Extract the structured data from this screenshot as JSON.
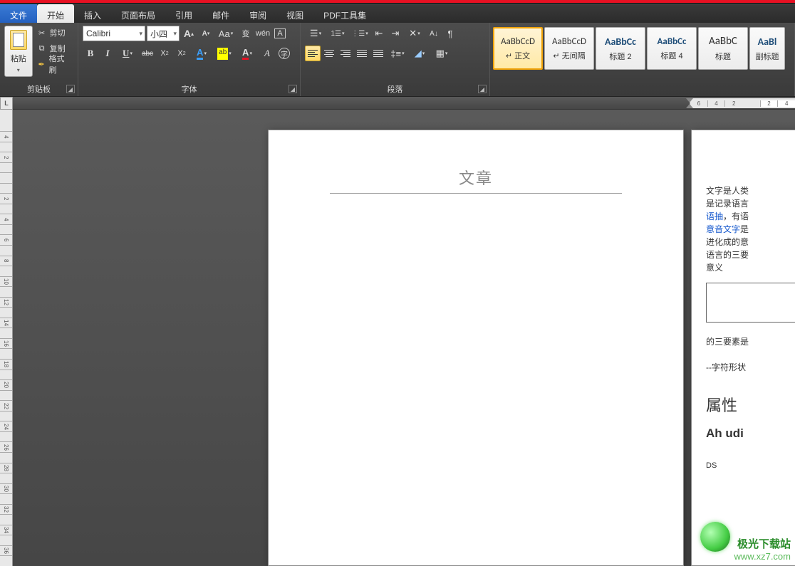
{
  "menu": {
    "file": "文件",
    "home": "开始",
    "insert": "插入",
    "layout": "页面布局",
    "references": "引用",
    "mail": "邮件",
    "review": "审阅",
    "view": "视图",
    "pdf": "PDF工具集"
  },
  "clipboard": {
    "group_label": "剪贴板",
    "paste": "粘贴",
    "cut": "剪切",
    "copy": "复制",
    "format_painter": "格式刷"
  },
  "font": {
    "group_label": "字体",
    "family": "Calibri",
    "size": "小四",
    "grow": "A",
    "shrink": "A",
    "aa": "Aa",
    "phonetic": "变",
    "char_border": "A",
    "bold": "B",
    "italic": "I",
    "underline": "U",
    "strike": "abc",
    "sub": "X₂",
    "sup": "X²",
    "text_effects": "A",
    "highlight": "ab",
    "font_color": "A",
    "char_shading": "A",
    "enclose": "字"
  },
  "paragraph": {
    "group_label": "段落"
  },
  "styles": {
    "preview": "AaBbCcD",
    "preview_cut": "AaBbCc",
    "preview_cut2": "AaBbC",
    "preview_cut3": "AaBl",
    "normal": "正文",
    "no_spacing": "无间隔",
    "heading2": "标题 2",
    "heading4": "标题 4",
    "title": "标题",
    "subtitle": "副标题"
  },
  "ruler_corner": "L",
  "h_ruler": [
    "6",
    "4",
    "2",
    "",
    "2",
    "4"
  ],
  "v_ruler": [
    "4",
    "",
    "2",
    "",
    "",
    "",
    "2",
    "",
    "4",
    "",
    "6",
    "",
    "8",
    "",
    "10",
    "",
    "12",
    "",
    "14",
    "",
    "16",
    "",
    "18",
    "",
    "20",
    "",
    "22",
    "",
    "24",
    "",
    "26",
    "",
    "28",
    "",
    "30",
    "",
    "32",
    "",
    "34",
    "",
    "36",
    ""
  ],
  "page1": {
    "header": "文章"
  },
  "page2": {
    "line1": "文字是人类",
    "line2": "是记录语言",
    "link1": "语抽",
    "line3": "，有语",
    "link2": "意音文字",
    "line4": "是",
    "line5": "进化成的意",
    "line6": "语言的三要",
    "line7": "意义",
    "line8": "的三要素是",
    "line9": "--字符形状",
    "heading": "属性",
    "subhead": "Ah udi",
    "small": "DS"
  },
  "watermark": {
    "text1": "极光下载站",
    "text2": "www.xz7.com"
  }
}
